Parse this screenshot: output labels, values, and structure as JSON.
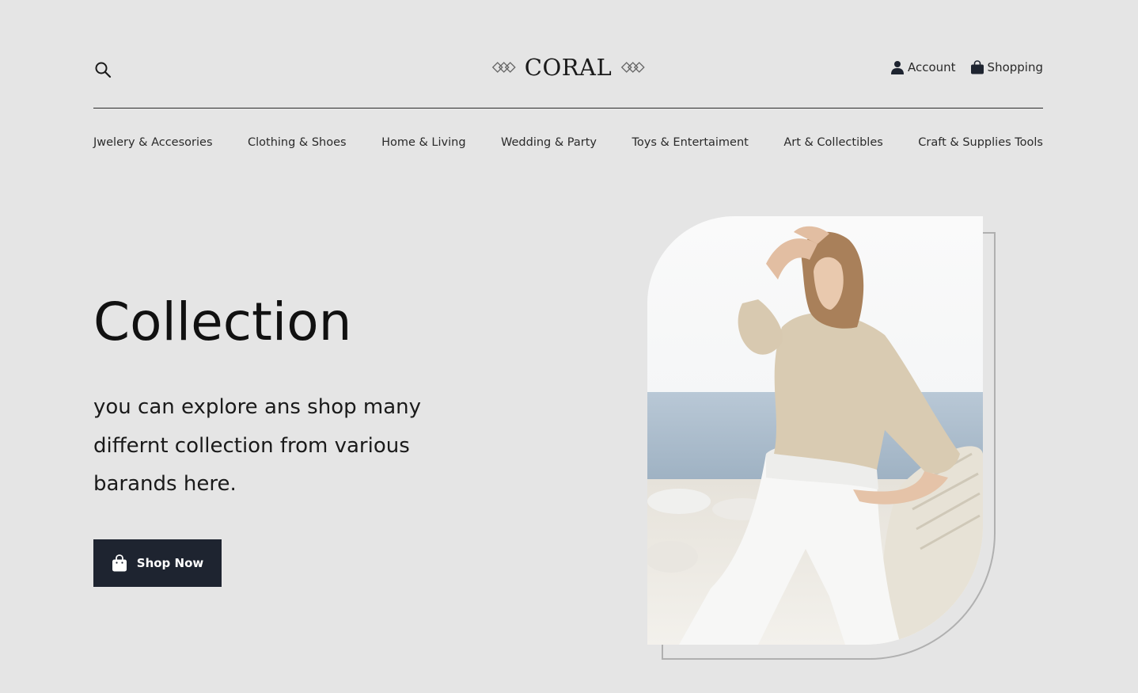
{
  "header": {
    "logo_text": "CORAL",
    "account_label": "Account",
    "shopping_label": "Shopping"
  },
  "nav": {
    "items": [
      {
        "label": "Jwelery & Accesories"
      },
      {
        "label": "Clothing & Shoes"
      },
      {
        "label": "Home & Living"
      },
      {
        "label": "Wedding & Party"
      },
      {
        "label": "Toys & Entertaiment"
      },
      {
        "label": "Art & Collectibles"
      },
      {
        "label": "Craft & Supplies Tools"
      }
    ]
  },
  "hero": {
    "title": "Collection",
    "text": "you can explore ans shop many differnt collection from various barands here.",
    "button_label": "Shop Now",
    "button_icon": "shopping-bag-icon"
  },
  "colors": {
    "background": "#e5e5e5",
    "button": "#1e2430",
    "text": "#1a1a1a"
  }
}
